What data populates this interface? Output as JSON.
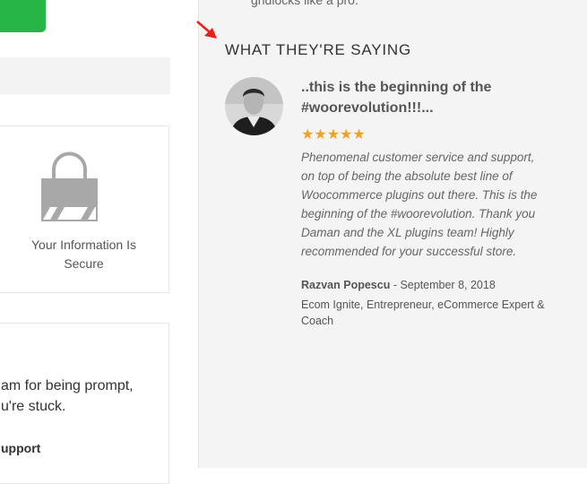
{
  "left": {
    "secure_label_line1": "Your Information Is",
    "secure_label_line2": "Secure",
    "support_line1": "am for being prompt,",
    "support_line2": "u're stuck.",
    "support_link": "upport"
  },
  "right": {
    "prev_text": "gridlocks like a pro.",
    "heading": "WHAT THEY'RE SAYING",
    "testimonial": {
      "title_line1": "..this is the beginning of the",
      "title_line2": "#woorevolution!!!...",
      "stars": "★★★★★",
      "rating": 5,
      "body_lines": [
        "Phenomenal customer service and support,",
        "on top of being the absolute best line of",
        "Woocommerce plugins out there. This is the",
        "beginning of the #woorevolution. Thank you",
        "Daman and the XL plugins team! Highly",
        "recommended for your successful store."
      ],
      "author": "Razvan Popescu",
      "date_sep": " - ",
      "date": "September 8, 2018",
      "role_line1": "Ecom Ignite, Entrepreneur, eCommerce Expert &",
      "role_line2": "Coach"
    }
  },
  "colors": {
    "green": "#27b548",
    "star": "#f2a21d",
    "arrow": "#e8201b",
    "panel_bg": "#f4f4f4"
  },
  "icons": [
    "lock-icon",
    "arrow-icon"
  ]
}
